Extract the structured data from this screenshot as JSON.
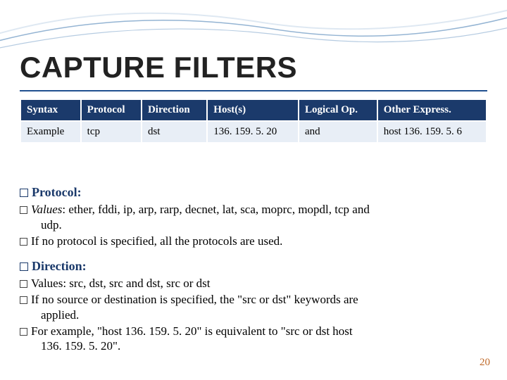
{
  "title": "CAPTURE FILTERS",
  "table": {
    "headers": [
      "Syntax",
      "Protocol",
      "Direction",
      "Host(s)",
      "Logical Op.",
      "Other Express."
    ],
    "row": [
      "Example",
      "tcp",
      "dst",
      "136. 159. 5. 20",
      "and",
      "host 136. 159. 5. 6"
    ]
  },
  "sections": {
    "protocol": {
      "heading": "Protocol:",
      "line1_label": "Values",
      "line1_text": ": ether, fddi, ip, arp, rarp, decnet, lat, sca, moprc, mopdl, tcp and",
      "line1_cont": "udp.",
      "line2": "If no protocol is specified, all the protocols are used."
    },
    "direction": {
      "heading": "Direction:",
      "line1": "Values: src, dst, src and dst, src or dst",
      "line2": "If no source or destination is specified, the \"src or dst\" keywords are",
      "line2_cont": "applied.",
      "line3": "For example, \"host 136. 159. 5. 20\" is equivalent to \"src or dst host",
      "line3_cont": "136. 159. 5. 20\"."
    }
  },
  "pagenum": "20"
}
